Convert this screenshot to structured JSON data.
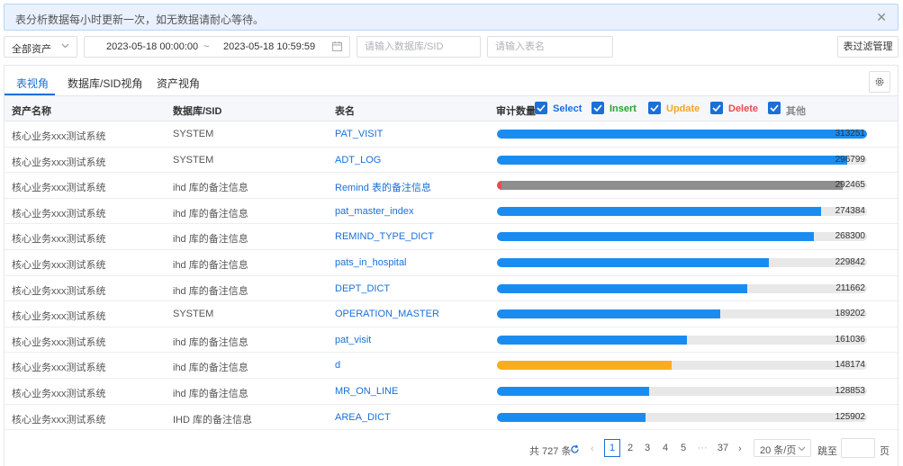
{
  "notice": {
    "text": "表分析数据每小时更新一次，如无数据请耐心等待。"
  },
  "filters": {
    "asset_value": "全部资产",
    "date_start": "2023-05-18 00:00:00",
    "date_sep": "~",
    "date_end": "2023-05-18 10:59:59",
    "db_placeholder": "请输入数据库/SID",
    "table_placeholder": "请输入表名",
    "filter_mgmt_label": "表过滤管理"
  },
  "tabs": [
    {
      "label": "表视角",
      "active": true
    },
    {
      "label": "数据库/SID视角",
      "active": false
    },
    {
      "label": "资产视角",
      "active": false
    }
  ],
  "columns": {
    "asset": "资产名称",
    "db": "数据库/SID",
    "table": "表名",
    "audit": "审计数量"
  },
  "legend": [
    {
      "label": "Select",
      "color": "#1a6fd8"
    },
    {
      "label": "Insert",
      "color": "#2ea12e"
    },
    {
      "label": "Update",
      "color": "#f5a623"
    },
    {
      "label": "Delete",
      "color": "#e84c4c"
    },
    {
      "label": "其他",
      "color": "#888888"
    }
  ],
  "colors": {
    "select": "#1a8cf0",
    "update": "#f9ad1e",
    "delete": "#e84c4c",
    "other": "#8e8e8e",
    "track": "#e8e8e8"
  },
  "chart_data": {
    "type": "bar",
    "orientation": "horizontal",
    "max": 313251,
    "rows": [
      {
        "asset": "核心业务xxx测试系统",
        "db": "SYSTEM",
        "table": "PAT_VISIT",
        "total": "313251",
        "segments": [
          {
            "kind": "select",
            "value": 313251
          }
        ]
      },
      {
        "asset": "核心业务xxx测试系统",
        "db": "SYSTEM",
        "table": "ADT_LOG",
        "total": "296799",
        "segments": [
          {
            "kind": "select",
            "value": 296799
          }
        ]
      },
      {
        "asset": "核心业务xxx测试系统",
        "db": "ihd 库的备注信息",
        "table": "Remind 表的备注信息",
        "total": "292465",
        "segments": [
          {
            "kind": "delete",
            "value": 4000
          },
          {
            "kind": "other",
            "value": 288465
          }
        ]
      },
      {
        "asset": "核心业务xxx测试系统",
        "db": "ihd 库的备注信息",
        "table": "pat_master_index",
        "total": "274384",
        "segments": [
          {
            "kind": "select",
            "value": 274384
          }
        ]
      },
      {
        "asset": "核心业务xxx测试系统",
        "db": "ihd 库的备注信息",
        "table": "REMIND_TYPE_DICT",
        "total": "268300",
        "segments": [
          {
            "kind": "select",
            "value": 268300
          }
        ]
      },
      {
        "asset": "核心业务xxx测试系统",
        "db": "ihd 库的备注信息",
        "table": "pats_in_hospital",
        "total": "229842",
        "segments": [
          {
            "kind": "select",
            "value": 229842
          }
        ]
      },
      {
        "asset": "核心业务xxx测试系统",
        "db": "ihd 库的备注信息",
        "table": "DEPT_DICT",
        "total": "211662",
        "segments": [
          {
            "kind": "select",
            "value": 211662
          }
        ]
      },
      {
        "asset": "核心业务xxx测试系统",
        "db": "SYSTEM",
        "table": "OPERATION_MASTER",
        "total": "189202",
        "segments": [
          {
            "kind": "select",
            "value": 189202
          }
        ]
      },
      {
        "asset": "核心业务xxx测试系统",
        "db": "ihd 库的备注信息",
        "table": "pat_visit",
        "total": "161036",
        "segments": [
          {
            "kind": "select",
            "value": 161036
          }
        ]
      },
      {
        "asset": "核心业务xxx测试系统",
        "db": "ihd 库的备注信息",
        "table": "d",
        "total": "148174",
        "segments": [
          {
            "kind": "update",
            "value": 148174
          }
        ]
      },
      {
        "asset": "核心业务xxx测试系统",
        "db": "ihd 库的备注信息",
        "table": "MR_ON_LINE",
        "total": "128853",
        "segments": [
          {
            "kind": "select",
            "value": 128853
          }
        ]
      },
      {
        "asset": "核心业务xxx测试系统",
        "db": "IHD 库的备注信息",
        "table": "AREA_DICT",
        "total": "125902",
        "segments": [
          {
            "kind": "select",
            "value": 125902
          }
        ]
      }
    ]
  },
  "pagination": {
    "total_label": "共 727 条",
    "pages": [
      "1",
      "2",
      "3",
      "4",
      "5"
    ],
    "ellipsis": "···",
    "last_page": "37",
    "current": "1",
    "page_size": "20 条/页",
    "jump_label": "跳至",
    "page_suffix": "页"
  }
}
